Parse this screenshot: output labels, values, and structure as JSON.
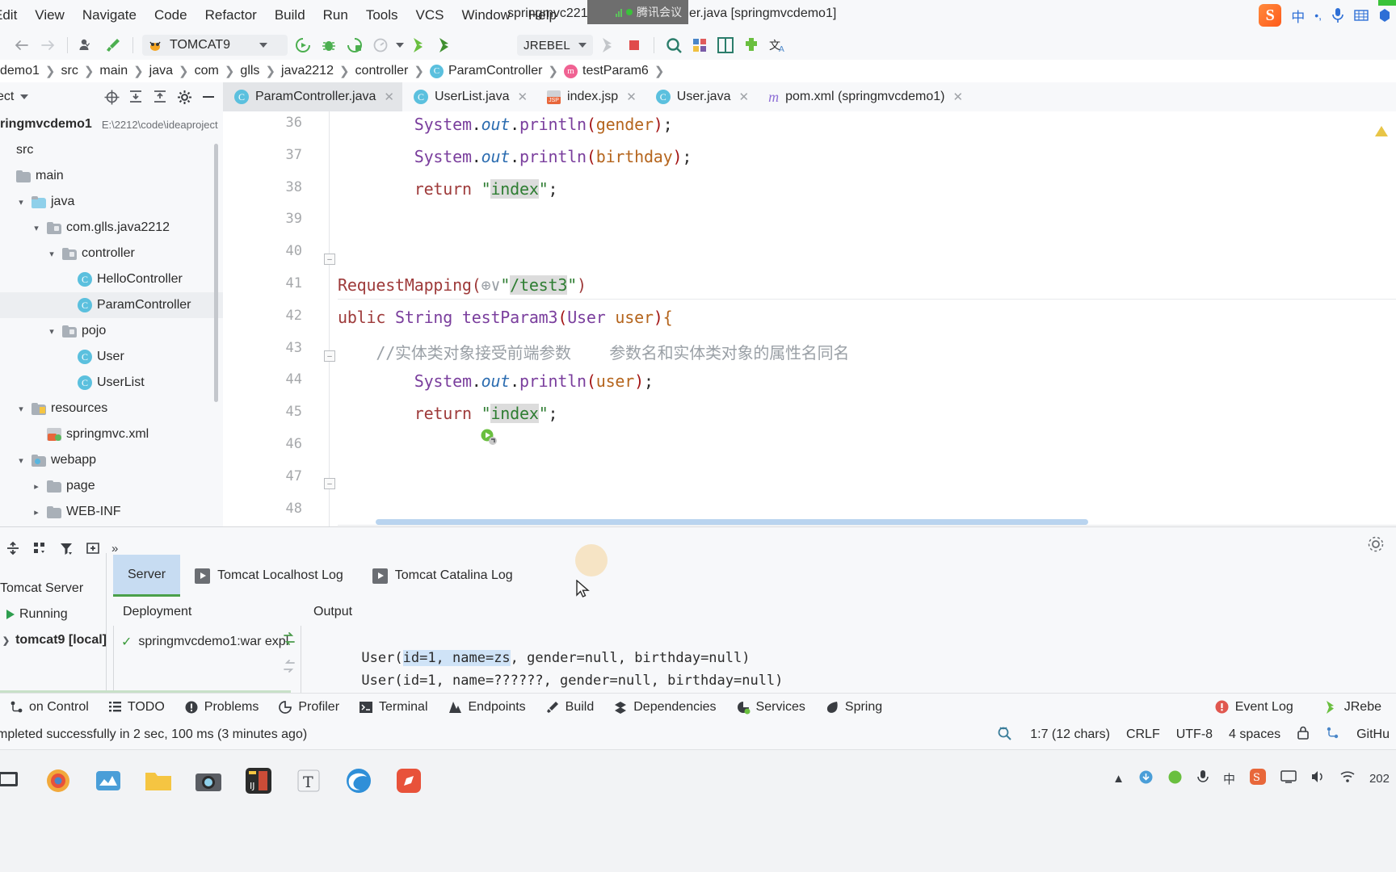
{
  "menu": {
    "items": [
      "Edit",
      "View",
      "Navigate",
      "Code",
      "Refactor",
      "Build",
      "Run",
      "Tools",
      "VCS",
      "Window",
      "Help"
    ],
    "window_title": "springmvc2212 - ParamController.java [springmvcdemo1]",
    "tencent_badge": "腾讯会议"
  },
  "toolbar": {
    "run_config": "TOMCAT9",
    "jrebel": "JREBEL"
  },
  "breadcrumb": {
    "items": [
      "demo1",
      "src",
      "main",
      "java",
      "com",
      "glls",
      "java2212",
      "controller",
      "ParamController",
      "testParam6"
    ],
    "class_badge": "C",
    "method_badge": "m"
  },
  "project_panel": {
    "title": "ect",
    "root_name": "ringmvcdemo1",
    "root_path": "E:\\2212\\code\\ideaproject",
    "tree": [
      {
        "label": "src",
        "indent": 0,
        "twisty": "",
        "icon": "none",
        "bold": false
      },
      {
        "label": "main",
        "indent": 0,
        "twisty": "",
        "icon": "folder",
        "bold": false
      },
      {
        "label": "java",
        "indent": 1,
        "twisty": "v",
        "icon": "source",
        "bold": false
      },
      {
        "label": "com.glls.java2212",
        "indent": 2,
        "twisty": "v",
        "icon": "package",
        "bold": false
      },
      {
        "label": "controller",
        "indent": 3,
        "twisty": "v",
        "icon": "package",
        "bold": false
      },
      {
        "label": "HelloController",
        "indent": 4,
        "twisty": "",
        "icon": "class",
        "bold": false
      },
      {
        "label": "ParamController",
        "indent": 4,
        "twisty": "",
        "icon": "class",
        "bold": false,
        "selected": true
      },
      {
        "label": "pojo",
        "indent": 3,
        "twisty": "v",
        "icon": "package",
        "bold": false
      },
      {
        "label": "User",
        "indent": 4,
        "twisty": "",
        "icon": "class",
        "bold": false
      },
      {
        "label": "UserList",
        "indent": 4,
        "twisty": "",
        "icon": "class",
        "bold": false
      },
      {
        "label": "resources",
        "indent": 1,
        "twisty": "v",
        "icon": "res",
        "bold": false
      },
      {
        "label": "springmvc.xml",
        "indent": 2,
        "twisty": "",
        "icon": "xml",
        "bold": false
      },
      {
        "label": "webapp",
        "indent": 1,
        "twisty": "v",
        "icon": "web",
        "bold": false
      },
      {
        "label": "page",
        "indent": 2,
        "twisty": ">",
        "icon": "folder",
        "bold": false
      },
      {
        "label": "WEB-INF",
        "indent": 2,
        "twisty": ">",
        "icon": "folder",
        "bold": false
      }
    ]
  },
  "editor_tabs": [
    {
      "label": "ParamController.java",
      "icon": "class",
      "active": true
    },
    {
      "label": "UserList.java",
      "icon": "class",
      "active": false
    },
    {
      "label": "index.jsp",
      "icon": "jsp",
      "active": false
    },
    {
      "label": "User.java",
      "icon": "class",
      "active": false
    },
    {
      "label": "pom.xml (springmvcdemo1)",
      "icon": "maven",
      "active": false
    }
  ],
  "editor": {
    "first_line": 36,
    "lines": [
      {
        "no": 36,
        "tokens": [
          {
            "t": "        ",
            "c": "k-dark"
          },
          {
            "t": "System",
            "c": "k-purple"
          },
          {
            "t": ".",
            "c": "k-dark"
          },
          {
            "t": "out",
            "c": "k-blue-i"
          },
          {
            "t": ".",
            "c": "k-dark"
          },
          {
            "t": "println",
            "c": "k-purple"
          },
          {
            "t": "(",
            "c": "k-red"
          },
          {
            "t": "gender",
            "c": "k-orange"
          },
          {
            "t": ")",
            "c": "k-red"
          },
          {
            "t": ";",
            "c": "k-dark"
          }
        ]
      },
      {
        "no": 37,
        "tokens": [
          {
            "t": "        ",
            "c": "k-dark"
          },
          {
            "t": "System",
            "c": "k-purple"
          },
          {
            "t": ".",
            "c": "k-dark"
          },
          {
            "t": "out",
            "c": "k-blue-i"
          },
          {
            "t": ".",
            "c": "k-dark"
          },
          {
            "t": "println",
            "c": "k-purple"
          },
          {
            "t": "(",
            "c": "k-red"
          },
          {
            "t": "birthday",
            "c": "k-orange"
          },
          {
            "t": ")",
            "c": "k-red"
          },
          {
            "t": ";",
            "c": "k-dark"
          }
        ]
      },
      {
        "no": 38,
        "tokens": [
          {
            "t": "        ",
            "c": "k-dark"
          },
          {
            "t": "return ",
            "c": "k-anno"
          },
          {
            "t": "\"",
            "c": "k-green"
          },
          {
            "t": "index",
            "c": "k-green hl"
          },
          {
            "t": "\"",
            "c": "k-green"
          },
          {
            "t": ";",
            "c": "k-dark"
          }
        ]
      },
      {
        "no": 39,
        "tokens": []
      },
      {
        "no": 40,
        "tokens": []
      },
      {
        "no": 41,
        "tokens": [
          {
            "t": "RequestMapping(",
            "c": "k-anno"
          },
          {
            "t": "⊕∨",
            "c": "k-cmt"
          },
          {
            "t": "\"",
            "c": "k-green"
          },
          {
            "t": "/test3",
            "c": "k-green hl"
          },
          {
            "t": "\"",
            "c": "k-green"
          },
          {
            "t": ")",
            "c": "k-anno"
          }
        ]
      },
      {
        "no": 42,
        "tokens": [
          {
            "t": "ublic ",
            "c": "k-anno"
          },
          {
            "t": "String",
            "c": "k-purple"
          },
          {
            "t": " testParam3",
            "c": "k-purple"
          },
          {
            "t": "(",
            "c": "k-red"
          },
          {
            "t": "User ",
            "c": "k-purple"
          },
          {
            "t": "user",
            "c": "k-orange"
          },
          {
            "t": ")",
            "c": "k-red"
          },
          {
            "t": "{",
            "c": "k-orange"
          }
        ]
      },
      {
        "no": 43,
        "tokens": [
          {
            "t": "    //实体类对象接受前端参数    参数名和实体类对象的属性名同名",
            "c": "k-cmt"
          }
        ]
      },
      {
        "no": 44,
        "tokens": [
          {
            "t": "        ",
            "c": "k-dark"
          },
          {
            "t": "System",
            "c": "k-purple"
          },
          {
            "t": ".",
            "c": "k-dark"
          },
          {
            "t": "out",
            "c": "k-blue-i"
          },
          {
            "t": ".",
            "c": "k-dark"
          },
          {
            "t": "println",
            "c": "k-purple"
          },
          {
            "t": "(",
            "c": "k-red"
          },
          {
            "t": "user",
            "c": "k-orange"
          },
          {
            "t": ")",
            "c": "k-red"
          },
          {
            "t": ";",
            "c": "k-dark"
          }
        ]
      },
      {
        "no": 45,
        "tokens": [
          {
            "t": "        ",
            "c": "k-dark"
          },
          {
            "t": "return ",
            "c": "k-anno"
          },
          {
            "t": "\"",
            "c": "k-green"
          },
          {
            "t": "index",
            "c": "k-green hl"
          },
          {
            "t": "\"",
            "c": "k-green"
          },
          {
            "t": ";",
            "c": "k-dark"
          }
        ]
      },
      {
        "no": 46,
        "tokens": []
      },
      {
        "no": 47,
        "tokens": []
      },
      {
        "no": 48,
        "tokens": []
      }
    ]
  },
  "bottom_panel": {
    "server_tree": {
      "title": "Tomcat Server",
      "status": "Running",
      "instance": "tomcat9 [local]"
    },
    "tabs": [
      {
        "label": "Server",
        "active": true,
        "icon": "none"
      },
      {
        "label": "Tomcat Localhost Log",
        "active": false,
        "icon": "play"
      },
      {
        "label": "Tomcat Catalina Log",
        "active": false,
        "icon": "play"
      }
    ],
    "col_deployment": "Deployment",
    "col_output": "Output",
    "deployment_item": "springmvcdemo1:war expl",
    "output_lines": [
      {
        "pre": "User(",
        "hl": "id=1, name=zs",
        "post": ", gender=null, birthday=null)"
      },
      {
        "pre": "User(id=1, name=??????, gender=null, birthday=null)",
        "hl": "",
        "post": ""
      }
    ]
  },
  "toolstrip": {
    "items": [
      {
        "label": "on Control",
        "icon": "vcs"
      },
      {
        "label": "TODO",
        "icon": "todo"
      },
      {
        "label": "Problems",
        "icon": "problems"
      },
      {
        "label": "Profiler",
        "icon": "profiler"
      },
      {
        "label": "Terminal",
        "icon": "terminal"
      },
      {
        "label": "Endpoints",
        "icon": "endpoints"
      },
      {
        "label": "Build",
        "icon": "build"
      },
      {
        "label": "Dependencies",
        "icon": "dependencies"
      },
      {
        "label": "Services",
        "icon": "services"
      },
      {
        "label": "Spring",
        "icon": "spring"
      }
    ],
    "right": [
      {
        "label": "Event Log",
        "icon": "eventlog"
      },
      {
        "label": "JRebe",
        "icon": "jrebel"
      }
    ]
  },
  "statusbar": {
    "message": "mpleted successfully in 2 sec, 100 ms (3 minutes ago)",
    "caret": "1:7 (12 chars)",
    "line_sep": "CRLF",
    "encoding": "UTF-8",
    "indent": "4 spaces",
    "branch": "GitHu"
  },
  "taskbar": {
    "clock": "202",
    "icons": [
      "windows",
      "files",
      "chrome",
      "editor",
      "folder",
      "camera",
      "idea",
      "text",
      "edge",
      "pen"
    ]
  },
  "colors": {
    "accent": "#4a86c8",
    "tab_active": "#c7dcf2",
    "green": "#3a9a3a",
    "panel_bg": "#f7f8fa",
    "selection": "#cfe3f7"
  }
}
